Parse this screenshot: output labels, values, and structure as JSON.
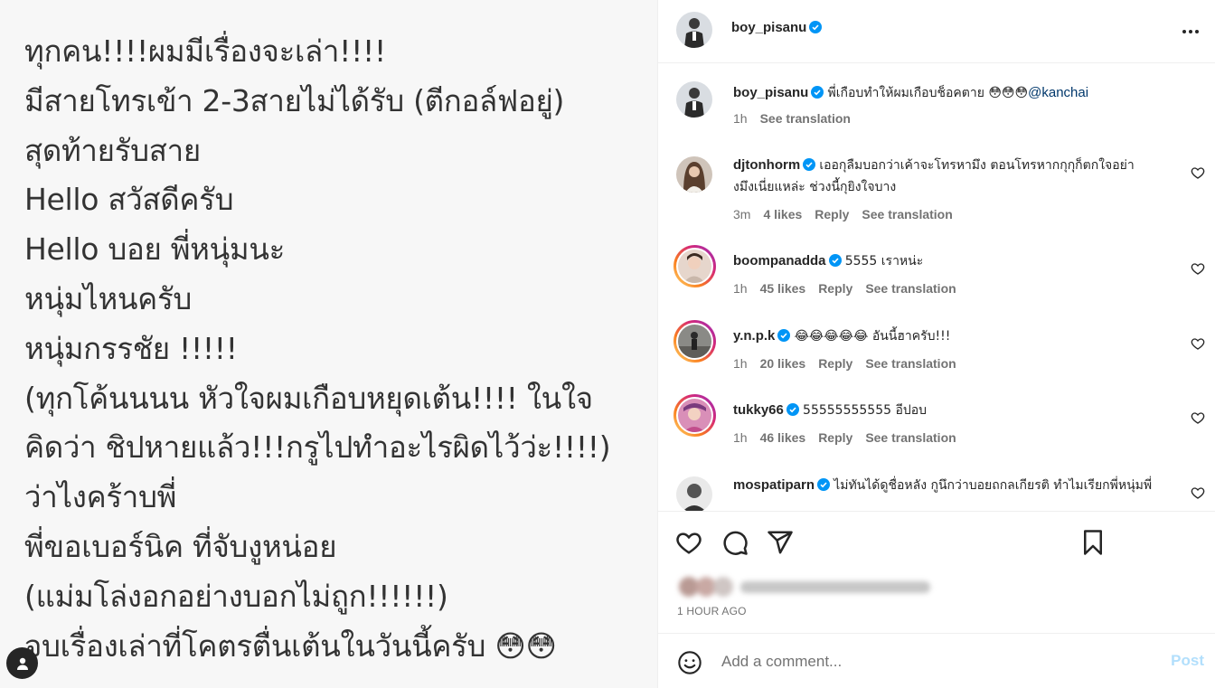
{
  "post": {
    "lines": [
      "ทุกคน!!!!ผมมีเรื่องจะเล่า!!!!",
      "มีสายโทรเข้า 2-3สายไม่ได้รับ (ตีกอล์ฟอยู่)",
      "สุดท้ายรับสาย",
      "Hello สวัสดีครับ",
      "Hello บอย พี่หนุ่มนะ",
      "หนุ่มไหนครับ",
      "หนุ่มกรรชัย !!!!!",
      "(ทุกโค้นนนน หัวใจผมเกือบหยุดเต้น!!!! ในใจ",
      "คิดว่า ชิปหายแล้ว!!!กรูไปทำอะไรผิดไว้ว่ะ!!!!)",
      "ว่าไงคร้าบพี่",
      "พี่ขอเบอร์นิค ที่จับงูหน่อย",
      "(แม่มโล่งอกอย่างบอกไม่ถูก!!!!!!)",
      "จบเรื่องเล่าที่โคตรตื่นเต้นในวันนี้ครับ 😳😳"
    ]
  },
  "header": {
    "username": "boy_pisanu",
    "more_icon": "more-horizontal-icon"
  },
  "caption": {
    "username": "boy_pisanu",
    "text": "พี่เกือบทำให้ผมเกือบช็อคตาย 😳😳😳",
    "mention": "@kanchai",
    "time": "1h",
    "translate": "See translation"
  },
  "comments": [
    {
      "username": "djtonhorm",
      "text": "เออกุลืมบอกว่าเค้าจะโทรหามึง ตอนโทรหากกุกุก็ตกใจอย่างมึงเนี่ยแหล่ะ ช่วงนี้กุยิงใจบาง",
      "time": "3m",
      "likes": "4 likes",
      "reply": "Reply",
      "translate": "See translation"
    },
    {
      "username": "boompanadda",
      "text": "5555 เราหน่ะ",
      "time": "1h",
      "likes": "45 likes",
      "reply": "Reply",
      "translate": "See translation"
    },
    {
      "username": "y.n.p.k",
      "text": "😂😂😂😂😂 อันนี้ฮาครับ!!!",
      "time": "1h",
      "likes": "20 likes",
      "reply": "Reply",
      "translate": "See translation"
    },
    {
      "username": "tukky66",
      "text": "55555555555 อีปอบ",
      "time": "1h",
      "likes": "46 likes",
      "reply": "Reply",
      "translate": "See translation"
    },
    {
      "username": "mospatiparn",
      "text": "ไม่ทันได้ดูชื่อหลัง กูนึกว่าบอยถกลเกียรติ ทำไมเรียกพี่หนุ่มพี่",
      "time": "",
      "likes": "",
      "reply": "",
      "translate": ""
    }
  ],
  "actions": {
    "time_ago": "1 HOUR AGO"
  },
  "add_comment": {
    "placeholder": "Add a comment...",
    "post_label": "Post"
  },
  "colors": {
    "verified": "#0095f6",
    "mention": "#00376b",
    "post_disabled": "#b2dffc"
  }
}
